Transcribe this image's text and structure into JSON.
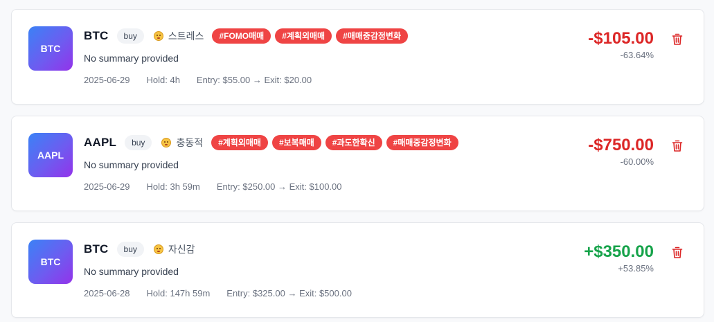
{
  "trades": [
    {
      "avatar": "BTC",
      "symbol": "BTC",
      "side": "buy",
      "emotion": {
        "label": "스트레스",
        "icon": "stressed-face-icon"
      },
      "tags": [
        "#FOMO매매",
        "#계획외매매",
        "#매매중감정변화"
      ],
      "summary": "No summary provided",
      "date": "2025-06-29",
      "hold": "Hold: 4h",
      "entry_exit": "Entry: $55.00 → Exit: $20.00",
      "pnl": "-$105.00",
      "pnl_pct": "-63.64%",
      "pnl_sign": "negative"
    },
    {
      "avatar": "AAPL",
      "symbol": "AAPL",
      "side": "buy",
      "emotion": {
        "label": "충동적",
        "icon": "impulsive-face-icon"
      },
      "tags": [
        "#계획외매매",
        "#보복매매",
        "#과도한확신",
        "#매매중감정변화"
      ],
      "summary": "No summary provided",
      "date": "2025-06-29",
      "hold": "Hold: 3h 59m",
      "entry_exit": "Entry: $250.00 → Exit: $100.00",
      "pnl": "-$750.00",
      "pnl_pct": "-60.00%",
      "pnl_sign": "negative"
    },
    {
      "avatar": "BTC",
      "symbol": "BTC",
      "side": "buy",
      "emotion": {
        "label": "자신감",
        "icon": "confident-face-icon"
      },
      "tags": [],
      "summary": "No summary provided",
      "date": "2025-06-28",
      "hold": "Hold: 147h 59m",
      "entry_exit": "Entry: $325.00 → Exit: $500.00",
      "pnl": "+$350.00",
      "pnl_pct": "+53.85%",
      "pnl_sign": "positive"
    }
  ],
  "colors": {
    "negative": "#dc2626",
    "positive": "#16a34a",
    "tag": "#ef4444",
    "delete_icon": "#dc2626"
  },
  "icons": {
    "delete": "trash-icon"
  }
}
